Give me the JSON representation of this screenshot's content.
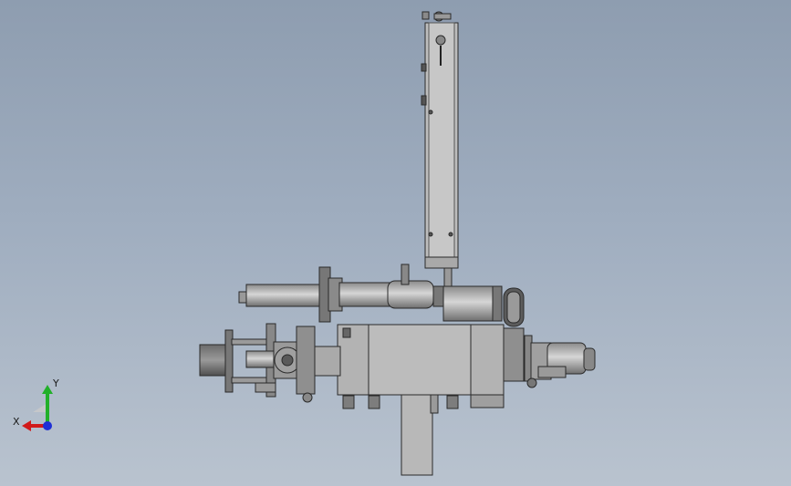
{
  "viewport": {
    "background_top": "#8e9db0",
    "background_bottom": "#b9c3cf"
  },
  "model": {
    "body_color": "#b3b3b3",
    "dark_color": "#6d6d6d",
    "edge_color": "#2a2a2a"
  },
  "triad": {
    "x_label": "X",
    "y_label": "Y",
    "x_color": "#d11a1a",
    "y_color": "#22b02a",
    "z_color": "#1e2fd6"
  }
}
